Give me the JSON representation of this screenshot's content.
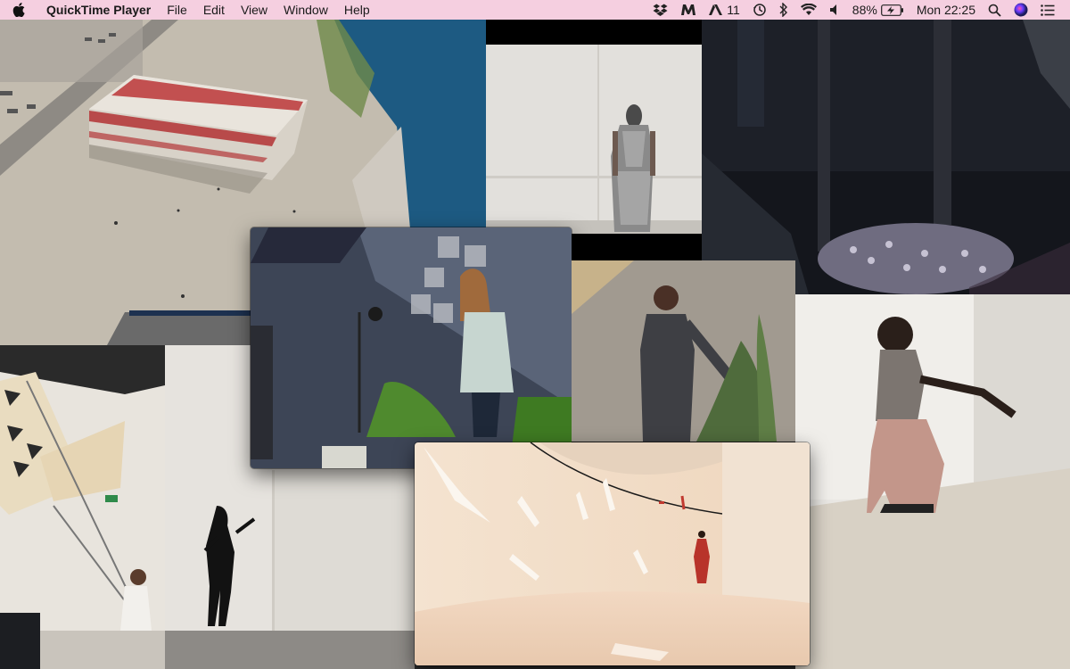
{
  "menubar": {
    "app_name": "QuickTime Player",
    "menus": [
      "File",
      "Edit",
      "View",
      "Window",
      "Help"
    ],
    "status": {
      "adobe_count": "11",
      "battery": "88%",
      "clock": "Mon 22:25"
    }
  },
  "windows": [
    {
      "name": "aerial-harbor-video",
      "subject": "aerial view of harbor building"
    },
    {
      "name": "metallic-dress-video",
      "subject": "figure in metallic dress"
    },
    {
      "name": "dark-night-video",
      "subject": "dark scene with patterned fabric"
    },
    {
      "name": "kite-installation-video",
      "subject": "installation with large sheets"
    },
    {
      "name": "silhouette-dancer-video",
      "subject": "dancer in gallery"
    },
    {
      "name": "microphone-performer-video",
      "subject": "performer at microphone"
    },
    {
      "name": "suited-man-video",
      "subject": "man in suit with plant"
    },
    {
      "name": "crouching-man-video",
      "subject": "man crouching against wall"
    },
    {
      "name": "curved-gallery-video",
      "subject": "dancer in curved white gallery"
    }
  ]
}
